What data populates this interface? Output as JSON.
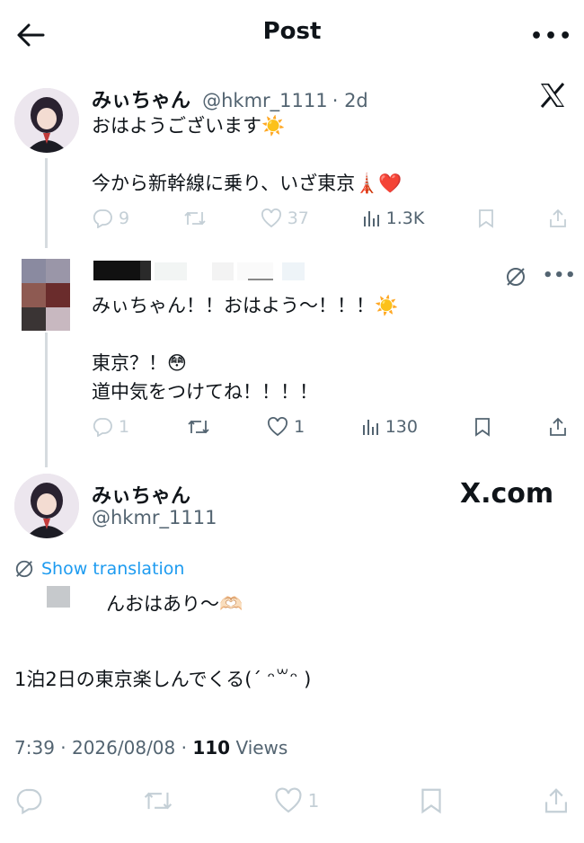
{
  "header": {
    "title": "Post"
  },
  "post1": {
    "name": "みぃちゃん",
    "handle": "@hkmr_1111",
    "time": "· 2d",
    "text": "おはようございます☀️\n\n今から新幹線に乗り、いざ東京🗼❤️",
    "stats": {
      "replies": "9",
      "reposts": "",
      "likes": "37",
      "views": "1.3K"
    }
  },
  "reply": {
    "text": "みぃちゃん！！おはよう〜！！！☀️\n\n東京？！😳\n道中気をつけてね！！！！",
    "stats": {
      "replies": "1",
      "reposts": "",
      "likes": "1",
      "views": "130"
    }
  },
  "main": {
    "name": "みぃちゃん",
    "handle": "@hkmr_1111",
    "watermark": "X.com",
    "translate_label": "Show translation",
    "line1": "んおはあり〜🫶🏻",
    "line2": "1泊2日の東京楽しんでくる(ˊ ᵔ꒳ᵔ )",
    "time": "7:39 · 2026/08/08 ·",
    "views_count": "110",
    "views_label": "Views",
    "stats": {
      "likes": "1"
    }
  },
  "colors": {
    "accent": "#1d9bf0",
    "muted": "#536471",
    "icon_light": "#c4cfd6",
    "heart": "#e0245e"
  }
}
